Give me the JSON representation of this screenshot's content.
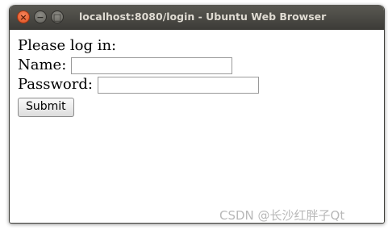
{
  "window": {
    "title": "localhost:8080/login - Ubuntu Web Browser",
    "controls": {
      "close": "×",
      "minimize": "−",
      "maximize": "□"
    }
  },
  "form": {
    "heading": "Please log in:",
    "name_label": "Name:",
    "name_value": "",
    "password_label": "Password:",
    "password_value": "",
    "submit_label": "Submit"
  },
  "watermark": "CSDN @长沙红胖子Qt",
  "colors": {
    "titlebar": "#3c3b37",
    "close_button": "#e0501e",
    "title_text": "#dfdbd2"
  }
}
